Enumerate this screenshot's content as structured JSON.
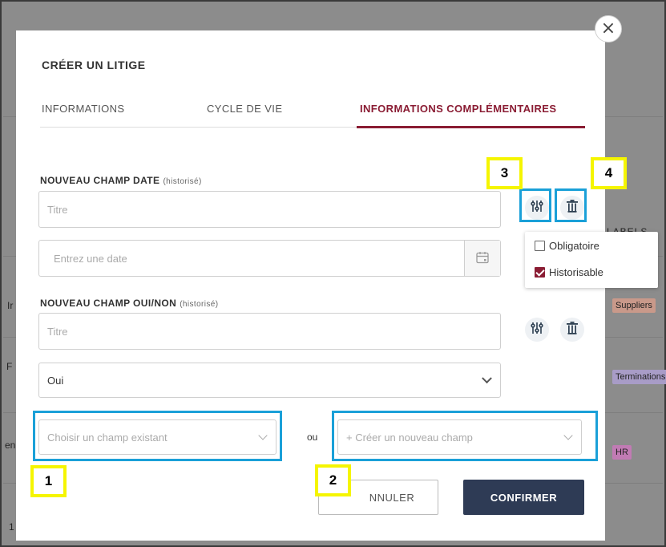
{
  "background": {
    "text_fragments": [
      "Ir",
      "F",
      "en",
      "1"
    ],
    "labels_header": "LABELS",
    "tags": [
      {
        "text": "Suppliers",
        "color": "#c9998a"
      },
      {
        "text": "Terminations",
        "color": "#a89cc7"
      },
      {
        "text": "HR",
        "color": "#c17bb4"
      }
    ]
  },
  "modal": {
    "close_glyph": "×",
    "title": "CRÉER UN LITIGE",
    "tabs": [
      {
        "label": "INFORMATIONS"
      },
      {
        "label": "CYCLE DE VIE"
      },
      {
        "label": "INFORMATIONS COMPLÉMENTAIRES",
        "active": true
      }
    ],
    "date_section": {
      "label": "NOUVEAU CHAMP DATE",
      "hist": "(historisé)",
      "title_placeholder": "Titre",
      "date_placeholder": "Entrez une date",
      "icons": [
        "settings-sliders-icon",
        "trash-icon",
        "calendar-icon"
      ]
    },
    "popover": {
      "options": [
        {
          "label": "Obligatoire",
          "checked": false
        },
        {
          "label": "Historisable",
          "checked": true
        }
      ]
    },
    "yesno_section": {
      "label": "NOUVEAU CHAMP OUI/NON",
      "hist": "(historisé)",
      "title_placeholder": "Titre",
      "value": "Oui"
    },
    "existing_field_placeholder": "Choisir un champ existant",
    "or_label": "ou",
    "new_field_placeholder": "+ Créer un nouveau champ",
    "cancel_label": "ANNULER",
    "cancel_visible": "NNULER",
    "confirm_label": "CONFIRMER"
  },
  "annotations": {
    "badges": [
      "1",
      "2",
      "3",
      "4"
    ],
    "highlight_color": "#1aa0d8",
    "badge_border_color": "#f5f500"
  },
  "colors": {
    "accent": "#8a1c33",
    "confirm_bg": "#2e3b55"
  }
}
